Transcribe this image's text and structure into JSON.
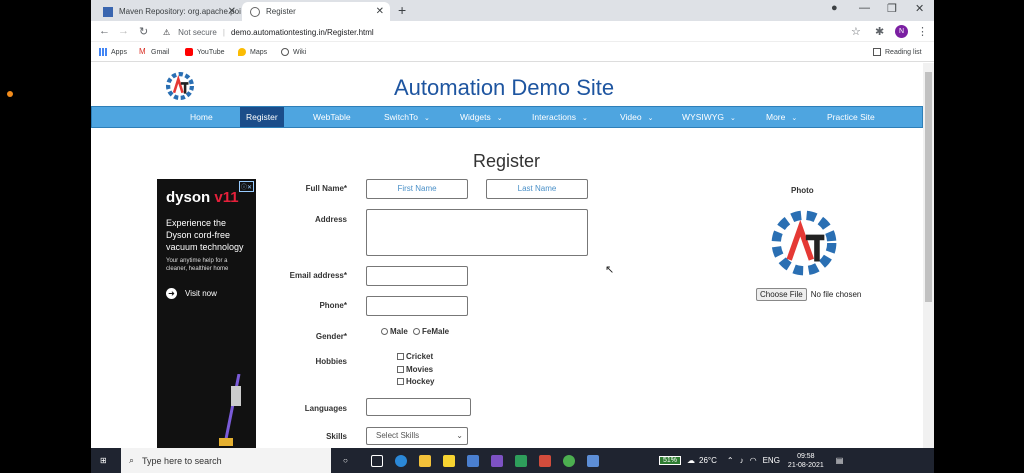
{
  "browser": {
    "tabs": [
      {
        "title": "Maven Repository: org.apache.poi"
      },
      {
        "title": "Register"
      }
    ],
    "new_tab": "+",
    "address": {
      "security": "Not secure",
      "url": "demo.automationtesting.in/Register.html"
    },
    "profile_initial": "N",
    "bookmarks": [
      "Apps",
      "Gmail",
      "YouTube",
      "Maps",
      "Wiki"
    ],
    "reading_list": "Reading list"
  },
  "site": {
    "title": "Automation Demo Site",
    "nav": [
      "Home",
      "Register",
      "WebTable",
      "SwitchTo",
      "Widgets",
      "Interactions",
      "Video",
      "WYSIWYG",
      "More",
      "Practice Site"
    ],
    "active_nav": "Register"
  },
  "form": {
    "heading": "Register",
    "full_name_label": "Full Name*",
    "first_name_placeholder": "First Name",
    "last_name_placeholder": "Last Name",
    "address_label": "Address",
    "email_label": "Email address*",
    "phone_label": "Phone*",
    "gender_label": "Gender*",
    "gender_options": [
      "Male",
      "FeMale"
    ],
    "hobbies_label": "Hobbies",
    "hobbies": [
      "Cricket",
      "Movies",
      "Hockey"
    ],
    "languages_label": "Languages",
    "skills_label": "Skills",
    "skills_selected": "Select Skills",
    "photo_label": "Photo",
    "choose_file": "Choose File",
    "no_file": "No file chosen"
  },
  "ad": {
    "brand": "dyson",
    "model": "v11",
    "headline": "Experience the Dyson cord-free vacuum technology",
    "sub": "Your anytime help for a cleaner, healthier home",
    "cta": "Visit now"
  },
  "taskbar": {
    "search_placeholder": "Type here to search",
    "battery": "51%",
    "weather": "26°C",
    "lang": "ENG",
    "time": "09:58",
    "date": "21-08-2021"
  },
  "colors": {
    "brand_blue": "#1e55a0",
    "nav_blue": "#4ea5e0",
    "nav_active": "#1b4d8a"
  }
}
